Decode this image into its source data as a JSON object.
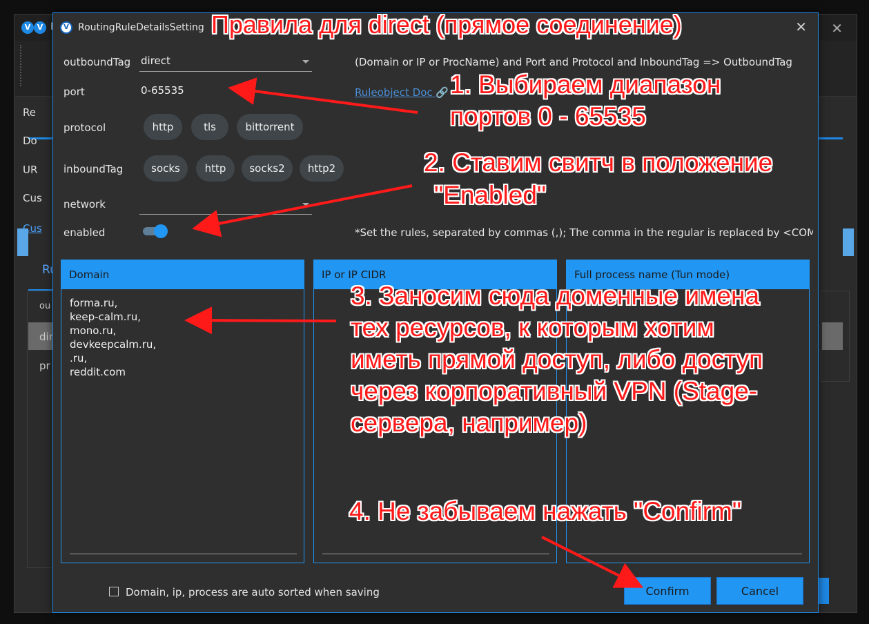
{
  "background_window": {
    "title_letter": "R",
    "sidebar_items": [
      "Re",
      "Do",
      "UR",
      "Cus"
    ],
    "sidebar_link": "Cus",
    "tab_label": "Ru",
    "rows": [
      "ou",
      "dir",
      "pr"
    ]
  },
  "dialog": {
    "title": "RoutingRuleDetailsSetting",
    "close_icon": "✕",
    "outboundTag": {
      "label": "outboundTag",
      "value": "direct"
    },
    "port": {
      "label": "port",
      "value": "0-65535"
    },
    "protocol": {
      "label": "protocol",
      "options": [
        "http",
        "tls",
        "bittorrent"
      ]
    },
    "inboundTag": {
      "label": "inboundTag",
      "options": [
        "socks",
        "http",
        "socks2",
        "http2"
      ]
    },
    "network": {
      "label": "network",
      "value": ""
    },
    "enabled": {
      "label": "enabled",
      "state": true
    },
    "info_text": "(Domain or IP or ProcName) and Port and Protocol and InboundTag => OutboundTag",
    "doc_link": "Ruleobject Doc",
    "note_text": "*Set the rules, separated by commas (,); The comma in the regular is replaced by <COMMA",
    "panes": [
      {
        "header": "Domain",
        "lines": [
          "forma.ru,",
          "keep-calm.ru,",
          "mono.ru,",
          "devkeepcalm.ru,",
          ".ru,",
          "reddit.com"
        ]
      },
      {
        "header": "IP or IP CIDR",
        "lines": []
      },
      {
        "header": "Full process name (Tun mode)",
        "lines": []
      }
    ],
    "auto_sort_label": "Domain, ip, process are auto sorted when saving",
    "confirm_label": "Confirm",
    "cancel_label": "Cancel"
  },
  "annotations": {
    "title": "Правила для direct (прямое соединение)",
    "step1": [
      "1. Выбираем диапазон",
      "портов 0 - 65535"
    ],
    "step2": [
      "2. Ставим свитч в положение",
      "\"Enabled\""
    ],
    "step3": [
      "3. Заносим сюда доменные имена",
      "тех ресурсов, к которым хотим",
      "иметь прямой доступ, либо доступ",
      "через корпоративный VPN (Stage-",
      "сервера, например)"
    ],
    "step4": "4. Не забываем нажать \"Confirm\"",
    "color": "#ff1a1a"
  },
  "colors": {
    "accent": "#2196f3",
    "dialog_bg": "#2f2f2f",
    "chip_bg": "#3f4549"
  }
}
